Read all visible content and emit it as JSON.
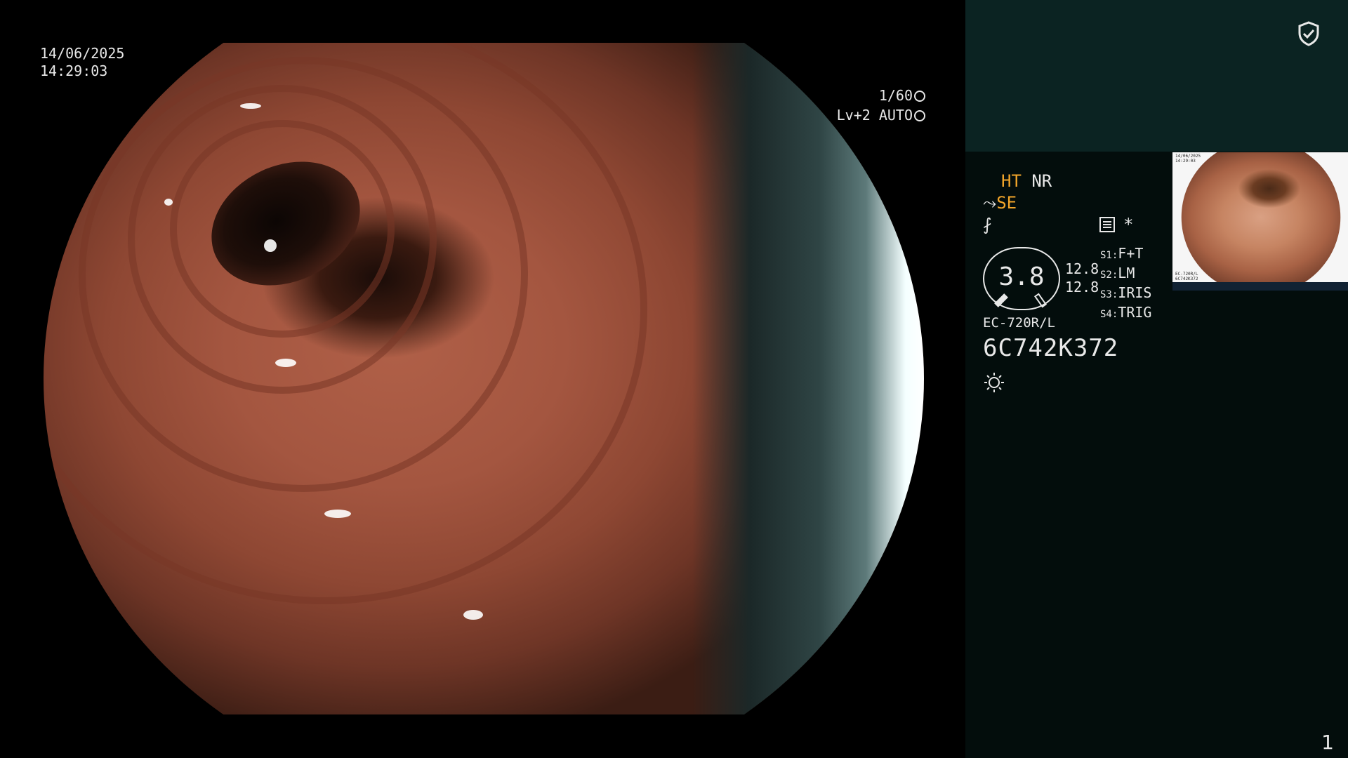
{
  "overlay": {
    "date": "14/06/2025",
    "time": "14:29:03",
    "shutter": "1/60",
    "level": "Lv+2 AUTO"
  },
  "panel": {
    "modes_line1_a": "HT",
    "modes_line1_b": "NR",
    "modes_line2": "SE",
    "brightness": "3.8",
    "value_top": "12.8",
    "value_bottom": "12.8",
    "switches": [
      {
        "key": "S1:",
        "value": "F+T"
      },
      {
        "key": "S2:",
        "value": "LM"
      },
      {
        "key": "S3:",
        "value": "IRIS"
      },
      {
        "key": "S4:",
        "value": "TRIG"
      }
    ],
    "model": "EC-720R/L",
    "serial": "6C742K372",
    "asterisk": "*",
    "page_number": "1"
  },
  "colors": {
    "accent": "#f2a52a",
    "panel_bg": "#030d0c",
    "panel_top_bg": "#0b2322"
  },
  "icons": [
    "shield-check-icon",
    "aperture-icon",
    "auto-iris-icon",
    "scope-tool-icon",
    "enhance-icon",
    "menu-card-icon",
    "light-source-icon"
  ]
}
